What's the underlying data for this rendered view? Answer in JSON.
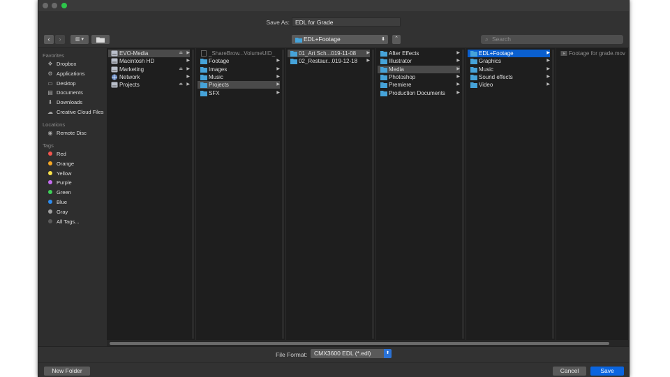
{
  "dialog": {
    "save_as_label": "Save As:",
    "filename": "EDL for Grade"
  },
  "toolbar": {
    "back": "‹",
    "forward": "›",
    "view_icon": "▥ ▾",
    "new_folder_icon": "📁",
    "location": "EDL+Footage",
    "expand": "⌃",
    "search_placeholder": "Search"
  },
  "sidebar": {
    "favorites_header": "Favorites",
    "favorites": [
      {
        "label": "Dropbox",
        "icon": "dropbox-icon"
      },
      {
        "label": "Applications",
        "icon": "applications-icon"
      },
      {
        "label": "Desktop",
        "icon": "desktop-icon"
      },
      {
        "label": "Documents",
        "icon": "documents-icon"
      },
      {
        "label": "Downloads",
        "icon": "downloads-icon"
      },
      {
        "label": "Creative Cloud Files",
        "icon": "creative-cloud-icon"
      }
    ],
    "locations_header": "Locations",
    "locations": [
      {
        "label": "Remote Disc",
        "icon": "disc-icon"
      }
    ],
    "tags_header": "Tags",
    "tags": [
      {
        "label": "Red",
        "color": "#f2544d"
      },
      {
        "label": "Orange",
        "color": "#f5a623"
      },
      {
        "label": "Yellow",
        "color": "#f8e04a"
      },
      {
        "label": "Purple",
        "color": "#c56cf0"
      },
      {
        "label": "Green",
        "color": "#3ed158"
      },
      {
        "label": "Blue",
        "color": "#2d8cf0"
      },
      {
        "label": "Gray",
        "color": "#a0a0a0"
      },
      {
        "label": "All Tags...",
        "color": "#5a5a5a"
      }
    ]
  },
  "columns": [
    [
      {
        "label": "EVO-Media",
        "type": "drive",
        "eject": true,
        "arrow": true,
        "selected": "gray"
      },
      {
        "label": "Macintosh HD",
        "type": "drive",
        "arrow": true
      },
      {
        "label": "Marketing",
        "type": "drive",
        "eject": true,
        "arrow": true
      },
      {
        "label": "Network",
        "type": "network",
        "arrow": true
      },
      {
        "label": "Projects",
        "type": "drive",
        "eject": true,
        "arrow": true
      }
    ],
    [
      {
        "label": "_ShareBrow...VolumeUID_",
        "type": "file",
        "dim": true
      },
      {
        "label": "Footage",
        "type": "folder",
        "arrow": true
      },
      {
        "label": "Images",
        "type": "folder",
        "arrow": true
      },
      {
        "label": "Music",
        "type": "folder",
        "arrow": true
      },
      {
        "label": "Projects",
        "type": "folder",
        "arrow": true,
        "selected": "gray"
      },
      {
        "label": "SFX",
        "type": "folder",
        "arrow": true
      }
    ],
    [
      {
        "label": "01_Art Sch...019-11-08",
        "type": "folder",
        "arrow": true,
        "selected": "gray"
      },
      {
        "label": "02_Restaur...019-12-18",
        "type": "folder",
        "arrow": true
      }
    ],
    [
      {
        "label": "After Effects",
        "type": "folder",
        "arrow": true
      },
      {
        "label": "Illustrator",
        "type": "folder",
        "arrow": true
      },
      {
        "label": "Media",
        "type": "folder",
        "arrow": true,
        "selected": "gray"
      },
      {
        "label": "Photoshop",
        "type": "folder",
        "arrow": true
      },
      {
        "label": "Premiere",
        "type": "folder",
        "arrow": true
      },
      {
        "label": "Production Documents",
        "type": "folder",
        "arrow": true
      }
    ],
    [
      {
        "label": "EDL+Footage",
        "type": "folder",
        "arrow": true,
        "selected": "blue"
      },
      {
        "label": "Graphics",
        "type": "folder",
        "arrow": true
      },
      {
        "label": "Music",
        "type": "folder",
        "arrow": true
      },
      {
        "label": "Sound effects",
        "type": "folder",
        "arrow": true
      },
      {
        "label": "Video",
        "type": "folder",
        "arrow": true
      }
    ],
    [
      {
        "label": "Footage for grade.mov",
        "type": "movie",
        "dim": true
      }
    ]
  ],
  "footer": {
    "file_format_label": "File Format:",
    "file_format_value": "CMX3600 EDL (*.edl)",
    "new_folder": "New Folder",
    "cancel": "Cancel",
    "save": "Save"
  }
}
